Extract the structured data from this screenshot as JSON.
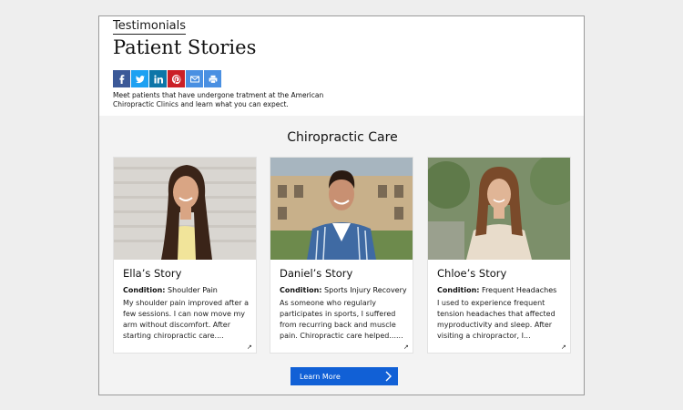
{
  "header": {
    "eyebrow": "Testimonials",
    "title": "Patient Stories",
    "intro": "Meet patients that have undergone tratment at the American Chiropractic Clinics and learn what you can expect."
  },
  "share": [
    {
      "icon": "facebook-icon",
      "glyph": "f",
      "color": "#3b5998"
    },
    {
      "icon": "twitter-icon",
      "glyph": "t",
      "color": "#1da1f2"
    },
    {
      "icon": "linkedin-icon",
      "glyph": "in",
      "color": "#0e76a8"
    },
    {
      "icon": "pinterest-icon",
      "glyph": "p",
      "color": "#cb2027"
    },
    {
      "icon": "email-icon",
      "glyph": "✉",
      "color": "#4a90e2"
    },
    {
      "icon": "print-icon",
      "glyph": "⎙",
      "color": "#4a90e2"
    }
  ],
  "section": {
    "title": "Chiropractic Care",
    "condition_label": "Condition:",
    "cards": [
      {
        "name": "Ella’s Story",
        "condition": "Shoulder Pain",
        "body": "My shoulder pain improved after a few sessions. I can now move my arm without discomfort. After starting chiropractic care...."
      },
      {
        "name": "Daniel’s Story",
        "condition": "Sports Injury Recovery",
        "body": "As someone who regularly participates in sports, I suffered from recurring back and muscle pain. Chiropractic care helped......"
      },
      {
        "name": "Chloe’s Story",
        "condition": "Frequent Headaches",
        "body": "I used to experience frequent tension headaches that affected myproductivity and sleep. After visiting a chiropractor, I..."
      }
    ]
  },
  "cta": {
    "label": "Learn More"
  },
  "colors": {
    "cta": "#1160d6",
    "section_bg": "#f3f3f3"
  }
}
